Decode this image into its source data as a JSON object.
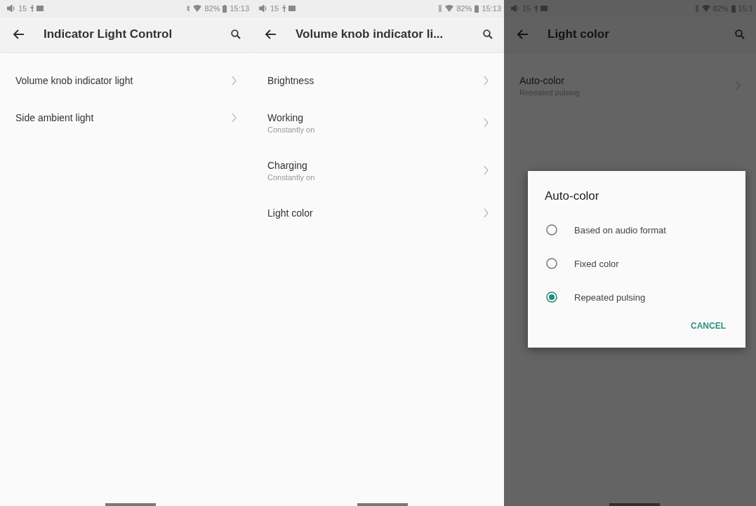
{
  "screens": [
    {
      "status_bar": {
        "left_text": "15",
        "bluetooth": true,
        "battery": "82%",
        "time": "15:13"
      },
      "header": {
        "title": "Indicator Light Control"
      },
      "items": [
        {
          "title": "Volume knob indicator light"
        },
        {
          "title": "Side ambient light"
        }
      ]
    },
    {
      "status_bar": {
        "left_text": "15",
        "bluetooth": false,
        "battery": "82%",
        "time": "15:13"
      },
      "header": {
        "title": "Volume knob indicator li..."
      },
      "items": [
        {
          "title": "Brightness"
        },
        {
          "title": "Working",
          "subtitle": "Constantly on"
        },
        {
          "title": "Charging",
          "subtitle": "Constantly on"
        },
        {
          "title": "Light color"
        }
      ]
    },
    {
      "status_bar": {
        "left_text": "15",
        "bluetooth": false,
        "battery": "82%",
        "time": "15:1"
      },
      "header": {
        "title": "Light color"
      },
      "items": [
        {
          "title": "Auto-color",
          "subtitle": "Repeated pulsing"
        }
      ],
      "dialog": {
        "title": "Auto-color",
        "options": [
          {
            "label": "Based on audio format",
            "selected": false
          },
          {
            "label": "Fixed color",
            "selected": false
          },
          {
            "label": "Repeated pulsing",
            "selected": true
          }
        ],
        "button": "CANCEL"
      }
    }
  ]
}
